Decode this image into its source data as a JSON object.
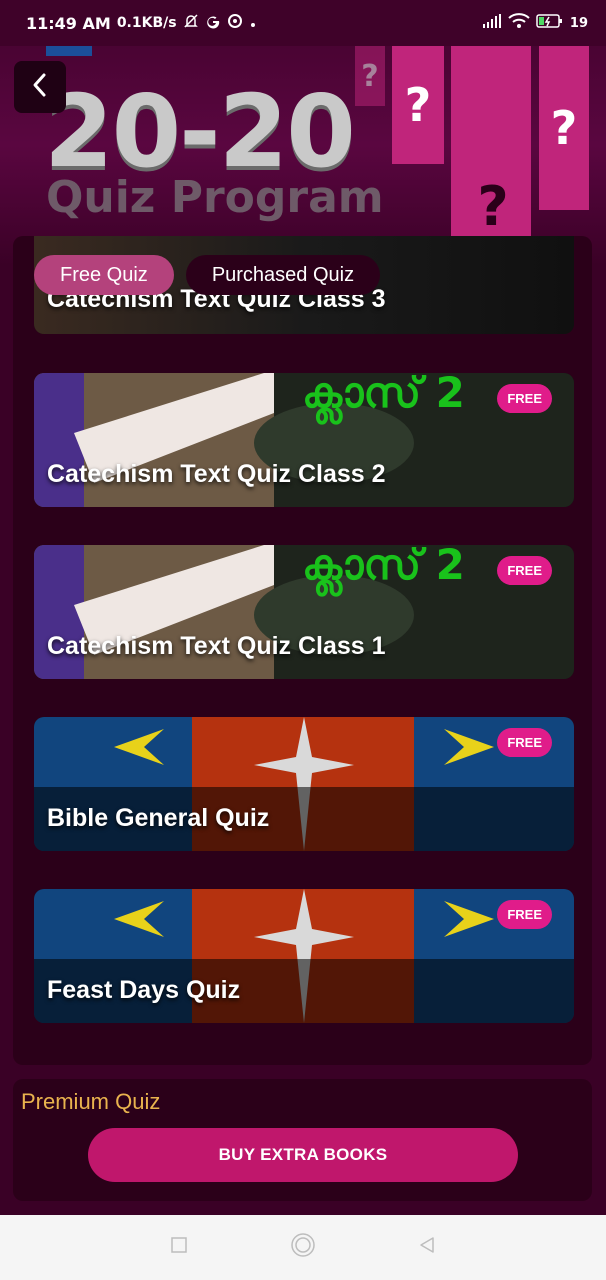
{
  "status_bar": {
    "time": "11:49 AM",
    "speed": "0.1KB/s",
    "battery": "19"
  },
  "banner": {
    "title": "20-20",
    "subtitle": "Quiz Program",
    "deco_marks": [
      "?",
      "?",
      "?",
      "?"
    ]
  },
  "tabs": [
    {
      "label": "Free Quiz",
      "active": true
    },
    {
      "label": "Purchased Quiz",
      "active": false
    }
  ],
  "quizzes": [
    {
      "title": "Catechism Text Quiz Class 3",
      "badge": ""
    },
    {
      "title": "Catechism Text Quiz Class 2",
      "badge": "FREE",
      "image_text": "ക്ലാസ് 2"
    },
    {
      "title": "Catechism Text Quiz Class 1",
      "badge": "FREE",
      "image_text": "ക്ലാസ് 2"
    },
    {
      "title": "Bible General Quiz",
      "badge": "FREE"
    },
    {
      "title": "Feast Days Quiz",
      "badge": "FREE"
    }
  ],
  "premium": {
    "title": "Premium Quiz",
    "button_label": "BUY EXTRA BOOKS"
  },
  "colors": {
    "background": "#3a0126",
    "panel": "#2b0019",
    "accent": "#c0176c",
    "tab_active": "#b4427c",
    "badge": "#e01c8a",
    "premium_title": "#e9b34e"
  },
  "icons": [
    "back-arrow-icon",
    "silent-icon",
    "google-icon",
    "sync-icon",
    "signal-icon",
    "wifi-icon",
    "battery-icon",
    "nav-recent-icon",
    "nav-home-icon",
    "nav-back-icon"
  ]
}
